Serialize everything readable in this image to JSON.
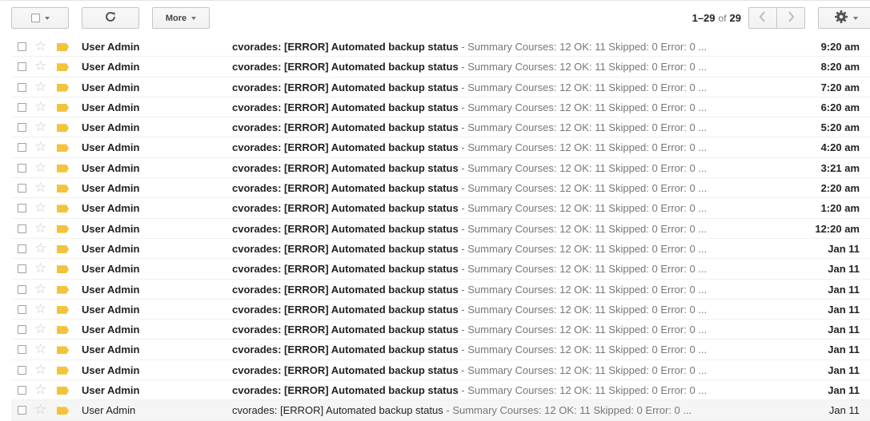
{
  "toolbar": {
    "more_label": "More",
    "pager": {
      "range": "1–29",
      "of": "of",
      "total": "29"
    }
  },
  "icons": {
    "refresh": "refresh-icon",
    "settings": "gear-icon",
    "prev": "chevron-left-icon",
    "next": "chevron-right-icon",
    "star": "star-icon",
    "label": "label-tag-icon"
  },
  "colors": {
    "label_tag": "#f3c33b",
    "read_row": "#f5f5f5",
    "snippet": "#777777"
  },
  "emails": [
    {
      "sender": "User Admin",
      "subject": "cvorades: [ERROR] Automated backup status",
      "snippet": "Summary Courses: 12 OK: 11 Skipped: 0 Error: 0 ...",
      "time": "9:20 am",
      "unread": true
    },
    {
      "sender": "User Admin",
      "subject": "cvorades: [ERROR] Automated backup status",
      "snippet": "Summary Courses: 12 OK: 11 Skipped: 0 Error: 0 ...",
      "time": "8:20 am",
      "unread": true
    },
    {
      "sender": "User Admin",
      "subject": "cvorades: [ERROR] Automated backup status",
      "snippet": "Summary Courses: 12 OK: 11 Skipped: 0 Error: 0 ...",
      "time": "7:20 am",
      "unread": true
    },
    {
      "sender": "User Admin",
      "subject": "cvorades: [ERROR] Automated backup status",
      "snippet": "Summary Courses: 12 OK: 11 Skipped: 0 Error: 0 ...",
      "time": "6:20 am",
      "unread": true
    },
    {
      "sender": "User Admin",
      "subject": "cvorades: [ERROR] Automated backup status",
      "snippet": "Summary Courses: 12 OK: 11 Skipped: 0 Error: 0 ...",
      "time": "5:20 am",
      "unread": true
    },
    {
      "sender": "User Admin",
      "subject": "cvorades: [ERROR] Automated backup status",
      "snippet": "Summary Courses: 12 OK: 11 Skipped: 0 Error: 0 ...",
      "time": "4:20 am",
      "unread": true
    },
    {
      "sender": "User Admin",
      "subject": "cvorades: [ERROR] Automated backup status",
      "snippet": "Summary Courses: 12 OK: 11 Skipped: 0 Error: 0 ...",
      "time": "3:21 am",
      "unread": true
    },
    {
      "sender": "User Admin",
      "subject": "cvorades: [ERROR] Automated backup status",
      "snippet": "Summary Courses: 12 OK: 11 Skipped: 0 Error: 0 ...",
      "time": "2:20 am",
      "unread": true
    },
    {
      "sender": "User Admin",
      "subject": "cvorades: [ERROR] Automated backup status",
      "snippet": "Summary Courses: 12 OK: 11 Skipped: 0 Error: 0 ...",
      "time": "1:20 am",
      "unread": true
    },
    {
      "sender": "User Admin",
      "subject": "cvorades: [ERROR] Automated backup status",
      "snippet": "Summary Courses: 12 OK: 11 Skipped: 0 Error: 0 ...",
      "time": "12:20 am",
      "unread": true
    },
    {
      "sender": "User Admin",
      "subject": "cvorades: [ERROR] Automated backup status",
      "snippet": "Summary Courses: 12 OK: 11 Skipped: 0 Error: 0 ...",
      "time": "Jan 11",
      "unread": true
    },
    {
      "sender": "User Admin",
      "subject": "cvorades: [ERROR] Automated backup status",
      "snippet": "Summary Courses: 12 OK: 11 Skipped: 0 Error: 0 ...",
      "time": "Jan 11",
      "unread": true
    },
    {
      "sender": "User Admin",
      "subject": "cvorades: [ERROR] Automated backup status",
      "snippet": "Summary Courses: 12 OK: 11 Skipped: 0 Error: 0 ...",
      "time": "Jan 11",
      "unread": true
    },
    {
      "sender": "User Admin",
      "subject": "cvorades: [ERROR] Automated backup status",
      "snippet": "Summary Courses: 12 OK: 11 Skipped: 0 Error: 0 ...",
      "time": "Jan 11",
      "unread": true
    },
    {
      "sender": "User Admin",
      "subject": "cvorades: [ERROR] Automated backup status",
      "snippet": "Summary Courses: 12 OK: 11 Skipped: 0 Error: 0 ...",
      "time": "Jan 11",
      "unread": true
    },
    {
      "sender": "User Admin",
      "subject": "cvorades: [ERROR] Automated backup status",
      "snippet": "Summary Courses: 12 OK: 11 Skipped: 0 Error: 0 ...",
      "time": "Jan 11",
      "unread": true
    },
    {
      "sender": "User Admin",
      "subject": "cvorades: [ERROR] Automated backup status",
      "snippet": "Summary Courses: 12 OK: 11 Skipped: 0 Error: 0 ...",
      "time": "Jan 11",
      "unread": true
    },
    {
      "sender": "User Admin",
      "subject": "cvorades: [ERROR] Automated backup status",
      "snippet": "Summary Courses: 12 OK: 11 Skipped: 0 Error: 0 ...",
      "time": "Jan 11",
      "unread": true
    },
    {
      "sender": "User Admin",
      "subject": "cvorades: [ERROR] Automated backup status",
      "snippet": "Summary Courses: 12 OK: 11 Skipped: 0 Error: 0 ...",
      "time": "Jan 11",
      "unread": false
    }
  ]
}
